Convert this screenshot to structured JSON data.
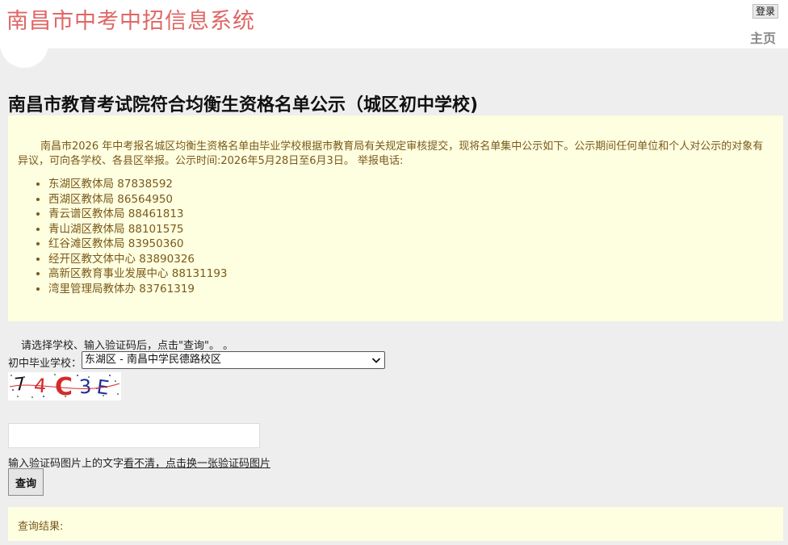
{
  "header": {
    "site_title": "南昌市中考中招信息系统",
    "login_label": "登录",
    "home_label": "主页"
  },
  "page_title": "南昌市教育考试院符合均衡生资格名单公示（城区初中学校)",
  "notice": {
    "text": "南昌市2026 年中考报名城区均衡生资格名单由毕业学校根据市教育局有关规定审核提交，现将名单集中公示如下。公示期间任何单位和个人对公示的对象有异议，可向各学校、各县区举报。公示时间:2026年5月28日至6月3日。     举报电话:",
    "phones": [
      "东湖区教体局 87838592",
      "西湖区教体局 86564950",
      "青云谱区教体局 88461813",
      "青山湖区教体局 88101575",
      "红谷滩区教体局 83950360",
      "经开区教文体中心 83890326",
      "高新区教育事业发展中心 88131193",
      "湾里管理局教体办 83761319"
    ]
  },
  "form": {
    "instruction": "请选择学校、输入验证码后，点击\"查询\"。 。",
    "school_label": "初中毕业学校：",
    "school_selected": "东湖区 - 南昌中学民德路校区",
    "captcha_text": "74C3E",
    "captcha_input_value": "",
    "captcha_hint": "输入验证码图片上的文字",
    "refresh_link": "看不清，点击换一张验证码图片",
    "query_label": "查询"
  },
  "result": {
    "label": "查询结果:"
  },
  "colors": {
    "title_red": "#e06666",
    "notice_bg": "#fefee0",
    "notice_text": "#7a5a1a",
    "page_bg": "#eeeeee"
  },
  "icons": {
    "select_arrow": "chevron-down-icon"
  }
}
